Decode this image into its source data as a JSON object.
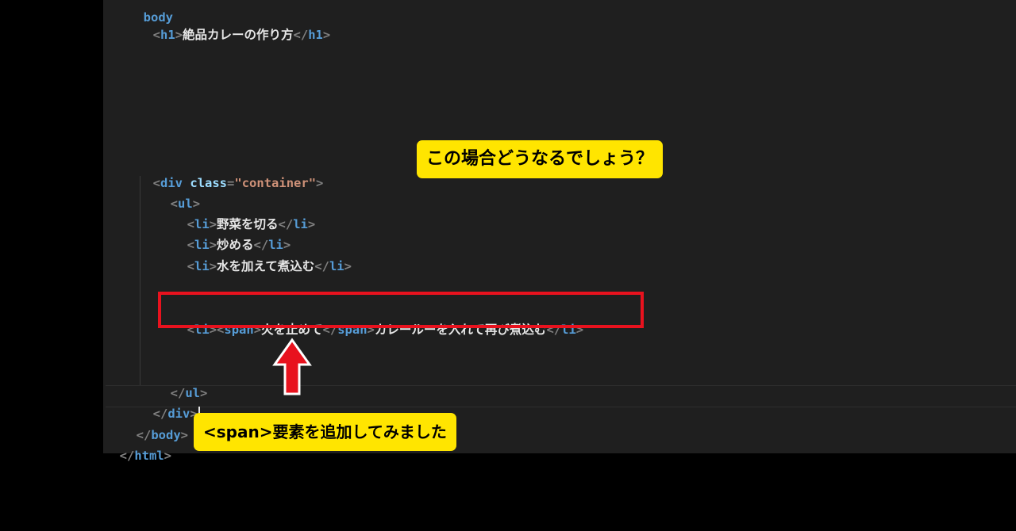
{
  "code": {
    "line_body_partial": "body",
    "line_h1": {
      "open": "h1",
      "text": "絶品カレーの作り方",
      "close": "h1"
    },
    "line_div_open": {
      "tag": "div",
      "attr": "class",
      "value": "\"container\""
    },
    "line_ul_open": "ul",
    "items": [
      {
        "tag": "li",
        "text": "野菜を切る"
      },
      {
        "tag": "li",
        "text": "炒める"
      },
      {
        "tag": "li",
        "text": "水を加えて煮込む"
      }
    ],
    "highlighted_item": {
      "li": "li",
      "span": "span",
      "span_text": "火を止めて",
      "rest_text": "カレールーを入れて再び煮込む"
    },
    "line_ul_close": "ul",
    "line_div_close": "div",
    "line_body_close": "body",
    "line_html_close": "html"
  },
  "callouts": {
    "question": "この場合どうなるでしょう？",
    "note": "<span>要素を追加してみました"
  },
  "colors": {
    "callout_bg": "#ffe500",
    "highlight_border": "#e8121e",
    "arrow": "#e8121e",
    "editor_bg": "#1f1f1f"
  }
}
